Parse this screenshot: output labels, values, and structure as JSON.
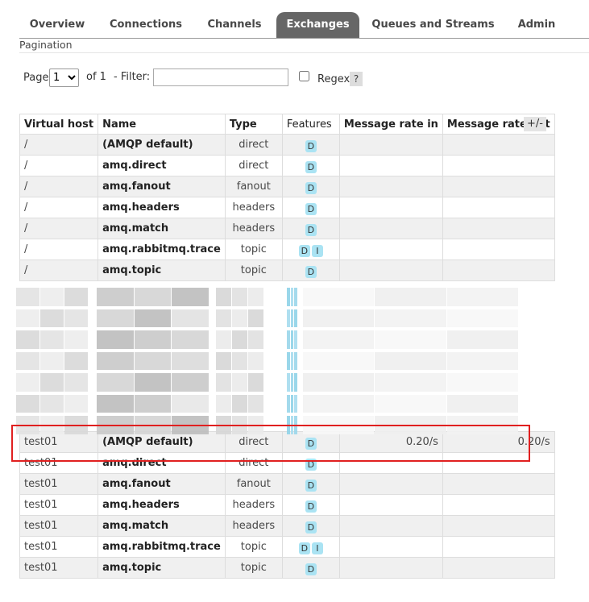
{
  "nav": {
    "tabs": [
      {
        "label": "Overview"
      },
      {
        "label": "Connections"
      },
      {
        "label": "Channels"
      },
      {
        "label": "Exchanges"
      },
      {
        "label": "Queues and Streams"
      },
      {
        "label": "Admin"
      }
    ],
    "active": "Exchanges"
  },
  "pagination": {
    "section_label": "Pagination",
    "page_label": "Page",
    "page_value": "1",
    "of_label": "of 1",
    "filter_label": "- Filter:",
    "filter_value": "",
    "regex_label": "Regex",
    "help_label": "?"
  },
  "table": {
    "headers": [
      "Virtual host",
      "Name",
      "Type",
      "Features",
      "Message rate in",
      "Message rate out"
    ],
    "plus_minus": "+/-",
    "rows_top": [
      {
        "vhost": "/",
        "name": "(AMQP default)",
        "type": "direct",
        "features": [
          "D"
        ],
        "rate_in": "",
        "rate_out": ""
      },
      {
        "vhost": "/",
        "name": "amq.direct",
        "type": "direct",
        "features": [
          "D"
        ],
        "rate_in": "",
        "rate_out": ""
      },
      {
        "vhost": "/",
        "name": "amq.fanout",
        "type": "fanout",
        "features": [
          "D"
        ],
        "rate_in": "",
        "rate_out": ""
      },
      {
        "vhost": "/",
        "name": "amq.headers",
        "type": "headers",
        "features": [
          "D"
        ],
        "rate_in": "",
        "rate_out": ""
      },
      {
        "vhost": "/",
        "name": "amq.match",
        "type": "headers",
        "features": [
          "D"
        ],
        "rate_in": "",
        "rate_out": ""
      },
      {
        "vhost": "/",
        "name": "amq.rabbitmq.trace",
        "type": "topic",
        "features": [
          "D",
          "I"
        ],
        "rate_in": "",
        "rate_out": ""
      },
      {
        "vhost": "/",
        "name": "amq.topic",
        "type": "topic",
        "features": [
          "D"
        ],
        "rate_in": "",
        "rate_out": ""
      }
    ],
    "rows_bottom": [
      {
        "vhost": "test01",
        "name": "(AMQP default)",
        "type": "direct",
        "features": [
          "D"
        ],
        "rate_in": "0.20/s",
        "rate_out": "0.20/s"
      },
      {
        "vhost": "test01",
        "name": "amq.direct",
        "type": "direct",
        "features": [
          "D"
        ],
        "rate_in": "",
        "rate_out": ""
      },
      {
        "vhost": "test01",
        "name": "amq.fanout",
        "type": "fanout",
        "features": [
          "D"
        ],
        "rate_in": "",
        "rate_out": ""
      },
      {
        "vhost": "test01",
        "name": "amq.headers",
        "type": "headers",
        "features": [
          "D"
        ],
        "rate_in": "",
        "rate_out": ""
      },
      {
        "vhost": "test01",
        "name": "amq.match",
        "type": "headers",
        "features": [
          "D"
        ],
        "rate_in": "",
        "rate_out": ""
      },
      {
        "vhost": "test01",
        "name": "amq.rabbitmq.trace",
        "type": "topic",
        "features": [
          "D",
          "I"
        ],
        "rate_in": "",
        "rate_out": ""
      },
      {
        "vhost": "test01",
        "name": "amq.topic",
        "type": "topic",
        "features": [
          "D"
        ],
        "rate_in": "",
        "rate_out": ""
      }
    ]
  },
  "colors": {
    "active_tab": "#666666",
    "feature_badge": "#aae3f3",
    "highlight_box": "#e02020",
    "row_alt": "#f0f0f0"
  }
}
